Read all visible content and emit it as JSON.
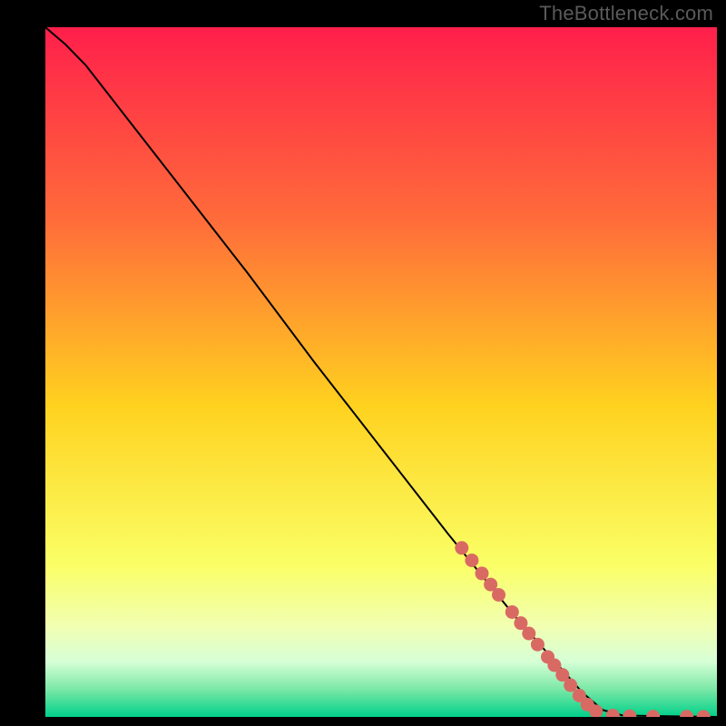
{
  "attribution": "TheBottleneck.com",
  "chart_data": {
    "type": "line",
    "title": "",
    "xlabel": "",
    "ylabel": "",
    "xlim": [
      0,
      100
    ],
    "ylim": [
      0,
      100
    ],
    "gradient_stops": [
      {
        "offset": 0,
        "color": "#ff1f4b"
      },
      {
        "offset": 28,
        "color": "#ff6c3a"
      },
      {
        "offset": 55,
        "color": "#ffd21f"
      },
      {
        "offset": 78,
        "color": "#faff66"
      },
      {
        "offset": 87,
        "color": "#f1ffb3"
      },
      {
        "offset": 92,
        "color": "#d6ffd6"
      },
      {
        "offset": 96,
        "color": "#7be8a6"
      },
      {
        "offset": 100,
        "color": "#00d08a"
      }
    ],
    "curve": [
      {
        "x": 0.0,
        "y": 100.0
      },
      {
        "x": 3.0,
        "y": 97.5
      },
      {
        "x": 6.0,
        "y": 94.5
      },
      {
        "x": 10.0,
        "y": 89.5
      },
      {
        "x": 20.0,
        "y": 77.0
      },
      {
        "x": 30.0,
        "y": 64.5
      },
      {
        "x": 40.0,
        "y": 51.5
      },
      {
        "x": 50.0,
        "y": 39.0
      },
      {
        "x": 60.0,
        "y": 26.5
      },
      {
        "x": 70.0,
        "y": 14.5
      },
      {
        "x": 80.0,
        "y": 3.5
      },
      {
        "x": 83.0,
        "y": 1.0
      },
      {
        "x": 86.0,
        "y": 0.2
      },
      {
        "x": 100.0,
        "y": 0.0
      }
    ],
    "markers": [
      {
        "x": 62.0,
        "y": 24.5
      },
      {
        "x": 63.5,
        "y": 22.7
      },
      {
        "x": 65.0,
        "y": 20.8
      },
      {
        "x": 66.3,
        "y": 19.2
      },
      {
        "x": 67.5,
        "y": 17.7
      },
      {
        "x": 69.5,
        "y": 15.2
      },
      {
        "x": 70.8,
        "y": 13.6
      },
      {
        "x": 72.0,
        "y": 12.1
      },
      {
        "x": 73.3,
        "y": 10.5
      },
      {
        "x": 74.8,
        "y": 8.7
      },
      {
        "x": 75.8,
        "y": 7.5
      },
      {
        "x": 77.0,
        "y": 6.1
      },
      {
        "x": 78.2,
        "y": 4.6
      },
      {
        "x": 79.5,
        "y": 3.1
      },
      {
        "x": 80.7,
        "y": 1.8
      },
      {
        "x": 82.0,
        "y": 0.8
      },
      {
        "x": 84.5,
        "y": 0.2
      },
      {
        "x": 87.0,
        "y": 0.1
      },
      {
        "x": 90.5,
        "y": 0.05
      },
      {
        "x": 95.5,
        "y": 0.03
      },
      {
        "x": 98.0,
        "y": 0.02
      }
    ],
    "marker_color": "#d96a63",
    "marker_radius": 7.5,
    "line_color": "#000000",
    "line_width": 2
  }
}
